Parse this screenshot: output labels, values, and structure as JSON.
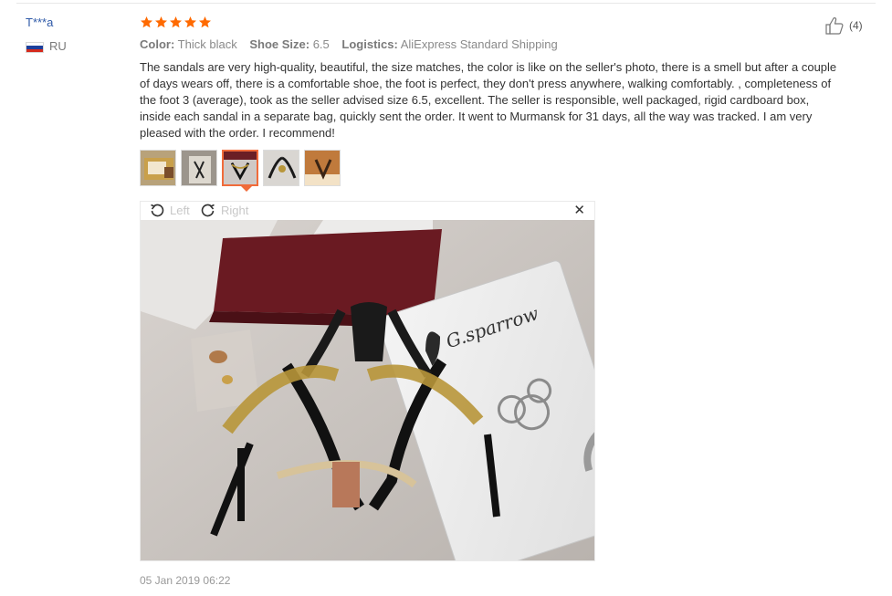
{
  "user": {
    "name": "T***a",
    "country_code": "RU",
    "flag_colors": [
      "#ffffff",
      "#1c3f9c",
      "#d52b1e"
    ]
  },
  "rating": {
    "stars": 5,
    "max": 5,
    "color": "#ff6a00"
  },
  "helpful": {
    "count": "(4)",
    "icon": "thumbs-up-icon"
  },
  "attributes": [
    {
      "label": "Color:",
      "value": "Thick black"
    },
    {
      "label": "Shoe Size:",
      "value": "6.5"
    },
    {
      "label": "Logistics:",
      "value": "AliExpress Standard Shipping"
    }
  ],
  "review_text": "The sandals are very high-quality, beautiful, the size matches, the color is like on the seller's photo, there is a smell but after a couple of days wears off, there is a comfortable shoe, the foot is perfect, they don't press anywhere, walking comfortably. , completeness of the foot 3 (average), took as the seller advised size 6.5, excellent. The seller is responsible, well packaged, rigid cardboard box, inside each sandal in a separate bag, quickly sent the order. It went to Murmansk for 31 days, all the way was tracked. I am very pleased with the order. I recommend!",
  "thumbnails": {
    "count": 5,
    "active_index": 2
  },
  "viewer": {
    "rotate_left_label": "Left",
    "rotate_right_label": "Right",
    "close_icon": "close-icon",
    "box_brand": "G.sparrow"
  },
  "date": "05 Jan 2019 06:22",
  "colors": {
    "link": "#2f5aa8",
    "accent": "#f06b3a",
    "star": "#ff6a00"
  }
}
